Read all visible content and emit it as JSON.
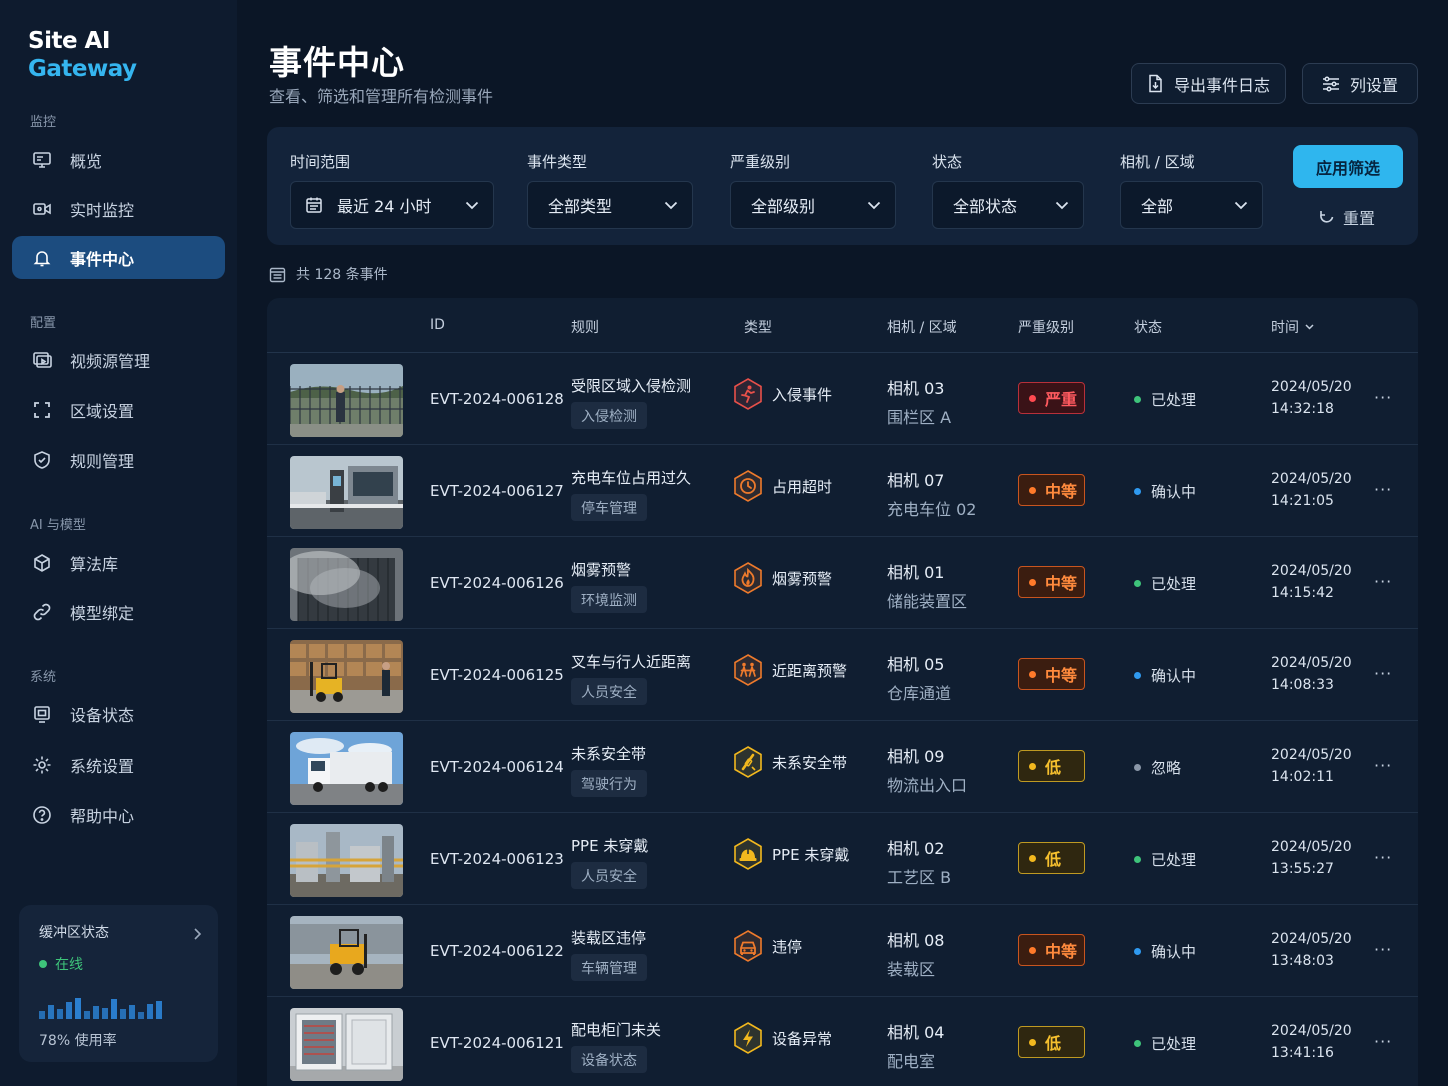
{
  "brand": {
    "line1": "Site AI",
    "line2": "Gateway"
  },
  "sidebar": {
    "sections": [
      "监控",
      "配置",
      "AI 与模型",
      "系统"
    ],
    "items": [
      {
        "label": "概览",
        "icon": "monitor-icon"
      },
      {
        "label": "实时监控",
        "icon": "video-camera-icon"
      },
      {
        "label": "事件中心",
        "icon": "bell-icon",
        "active": true
      },
      {
        "label": "视频源管理",
        "icon": "video-source-icon"
      },
      {
        "label": "区域设置",
        "icon": "area-frame-icon"
      },
      {
        "label": "规则管理",
        "icon": "shield-check-icon"
      },
      {
        "label": "算法库",
        "icon": "cube-icon"
      },
      {
        "label": "模型绑定",
        "icon": "link-icon"
      },
      {
        "label": "设备状态",
        "icon": "device-icon"
      },
      {
        "label": "系统设置",
        "icon": "gear-icon"
      },
      {
        "label": "帮助中心",
        "icon": "help-circle-icon"
      }
    ],
    "buffer": {
      "title": "缓冲区状态",
      "status": "在线",
      "usage": "78% 使用率",
      "bars": [
        0.3,
        0.5,
        0.35,
        0.6,
        0.75,
        0.3,
        0.45,
        0.4,
        0.7,
        0.35,
        0.5,
        0.25,
        0.55,
        0.65
      ]
    }
  },
  "header": {
    "title": "事件中心",
    "subtitle": "查看、筛选和管理所有检测事件",
    "export_label": "导出事件日志",
    "columns_label": "列设置"
  },
  "filters": {
    "time": {
      "label": "时间范围",
      "value": "最近 24 小时"
    },
    "type": {
      "label": "事件类型",
      "value": "全部类型"
    },
    "severity": {
      "label": "严重级别",
      "value": "全部级别"
    },
    "status": {
      "label": "状态",
      "value": "全部状态"
    },
    "camera": {
      "label": "相机 / 区域",
      "value": "全部"
    },
    "apply_label": "应用筛选",
    "reset_label": "重置"
  },
  "count_text": "共 128 条事件",
  "table": {
    "headers": {
      "id": "ID",
      "rule": "规则",
      "type": "类型",
      "camera": "相机 / 区域",
      "severity": "严重级别",
      "status": "状态",
      "time": "时间"
    },
    "rows": [
      {
        "id": "EVT-2024-006128",
        "rule": "受限区域入侵检测",
        "tag": "入侵检测",
        "type": "入侵事件",
        "type_icon": "running-person-icon",
        "type_color": "#e8504a",
        "camera": "相机 03",
        "zone": "围栏区 A",
        "severity": "严重",
        "sev_level": "high",
        "status": "已处理",
        "status_color": "#3ec47a",
        "date": "2024/05/20",
        "time": "14:32:18",
        "thumb": "fence-scene"
      },
      {
        "id": "EVT-2024-006127",
        "rule": "充电车位占用过久",
        "tag": "停车管理",
        "type": "占用超时",
        "type_icon": "clock-icon",
        "type_color": "#ee7a2c",
        "camera": "相机 07",
        "zone": "充电车位 02",
        "severity": "中等",
        "sev_level": "mid",
        "status": "确认中",
        "status_color": "#2f9af0",
        "date": "2024/05/20",
        "time": "14:21:05",
        "thumb": "charger-scene"
      },
      {
        "id": "EVT-2024-006126",
        "rule": "烟雾预警",
        "tag": "环境监测",
        "type": "烟雾预警",
        "type_icon": "flame-icon",
        "type_color": "#ee7a2c",
        "camera": "相机 01",
        "zone": "储能装置区",
        "severity": "中等",
        "sev_level": "mid",
        "status": "已处理",
        "status_color": "#3ec47a",
        "date": "2024/05/20",
        "time": "14:15:42",
        "thumb": "smoke-scene"
      },
      {
        "id": "EVT-2024-006125",
        "rule": "叉车与行人近距离",
        "tag": "人员安全",
        "type": "近距离预警",
        "type_icon": "proximity-people-icon",
        "type_color": "#ee7a2c",
        "camera": "相机 05",
        "zone": "仓库通道",
        "severity": "中等",
        "sev_level": "mid",
        "status": "确认中",
        "status_color": "#2f9af0",
        "date": "2024/05/20",
        "time": "14:08:33",
        "thumb": "forklift-scene"
      },
      {
        "id": "EVT-2024-006124",
        "rule": "未系安全带",
        "tag": "驾驶行为",
        "type": "未系安全带",
        "type_icon": "seatbelt-icon",
        "type_color": "#f2b81e",
        "camera": "相机 09",
        "zone": "物流出入口",
        "severity": "低",
        "sev_level": "low",
        "status": "忽略",
        "status_color": "#8a97a8",
        "date": "2024/05/20",
        "time": "14:02:11",
        "thumb": "truck-scene"
      },
      {
        "id": "EVT-2024-006123",
        "rule": "PPE 未穿戴",
        "tag": "人员安全",
        "type": "PPE 未穿戴",
        "type_icon": "hardhat-icon",
        "type_color": "#f2b81e",
        "camera": "相机 02",
        "zone": "工艺区 B",
        "severity": "低",
        "sev_level": "low",
        "status": "已处理",
        "status_color": "#3ec47a",
        "date": "2024/05/20",
        "time": "13:55:27",
        "thumb": "plant-scene"
      },
      {
        "id": "EVT-2024-006122",
        "rule": "装载区违停",
        "tag": "车辆管理",
        "type": "违停",
        "type_icon": "car-icon",
        "type_color": "#ee7a2c",
        "camera": "相机 08",
        "zone": "装载区",
        "severity": "中等",
        "sev_level": "mid",
        "status": "确认中",
        "status_color": "#2f9af0",
        "date": "2024/05/20",
        "time": "13:48:03",
        "thumb": "loader-scene"
      },
      {
        "id": "EVT-2024-006121",
        "rule": "配电柜门未关",
        "tag": "设备状态",
        "type": "设备异常",
        "type_icon": "lightning-icon",
        "type_color": "#f2b81e",
        "camera": "相机 04",
        "zone": "配电室",
        "severity": "低",
        "sev_level": "low",
        "status": "已处理",
        "status_color": "#3ec47a",
        "date": "2024/05/20",
        "time": "13:41:16",
        "thumb": "cabinet-scene"
      }
    ]
  }
}
